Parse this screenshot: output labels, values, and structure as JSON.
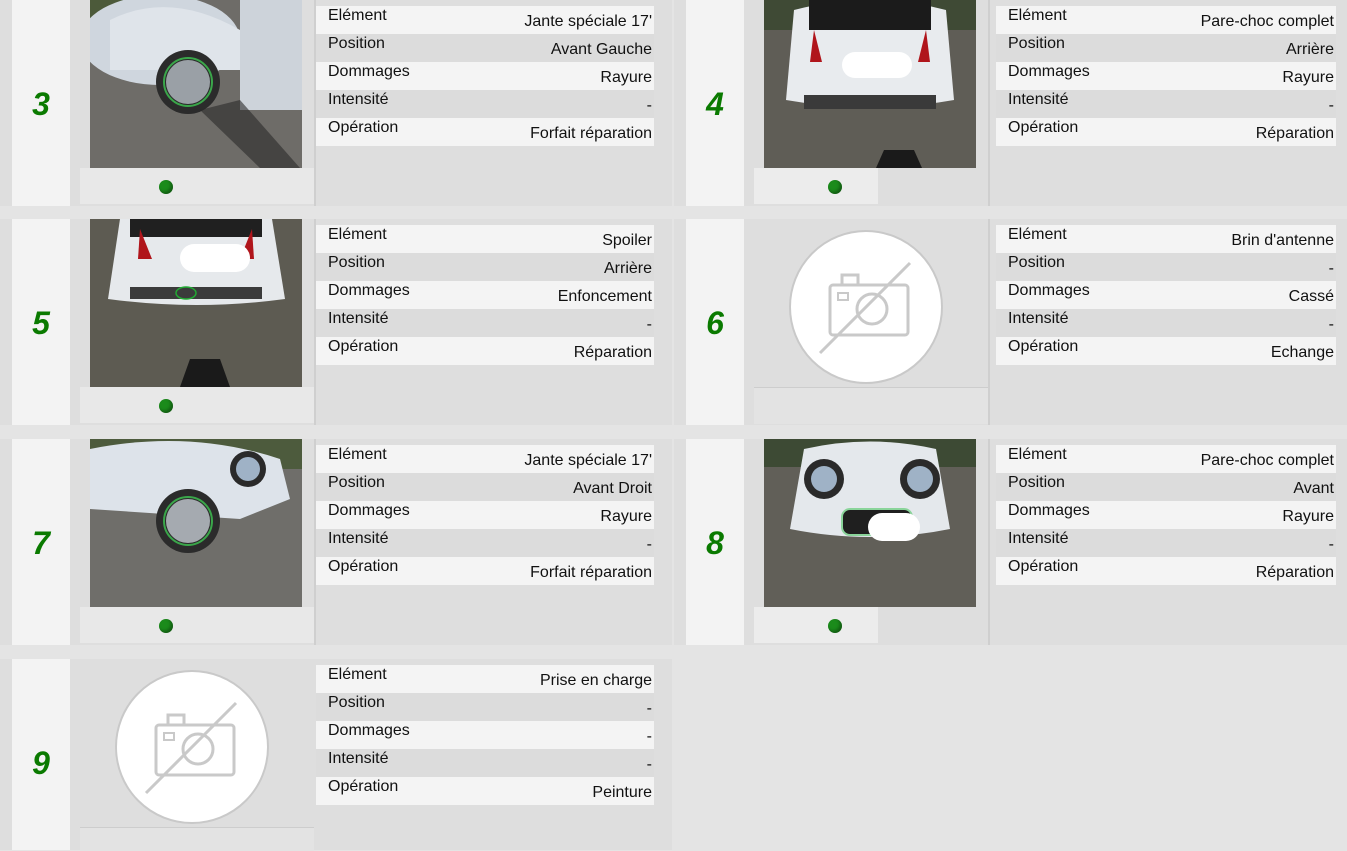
{
  "labels": {
    "element": "Elément",
    "position": "Position",
    "dommages": "Dommages",
    "intensite": "Intensité",
    "operation": "Opération"
  },
  "colors": {
    "number": "#0a7a00",
    "status_dot": "#1b8b1b"
  },
  "cards": [
    {
      "number": "3",
      "has_photo": true,
      "status": "ok",
      "element": "Jante spéciale 17'",
      "position": "Avant Gauche",
      "dommages": "Rayure",
      "intensite": "-",
      "operation": "Forfait réparation"
    },
    {
      "number": "4",
      "has_photo": true,
      "status": "ok",
      "element": "Pare-choc complet",
      "position": "Arrière",
      "dommages": "Rayure",
      "intensite": "-",
      "operation": "Réparation"
    },
    {
      "number": "5",
      "has_photo": true,
      "status": "ok",
      "element": "Spoiler",
      "position": "Arrière",
      "dommages": "Enfoncement",
      "intensite": "-",
      "operation": "Réparation"
    },
    {
      "number": "6",
      "has_photo": false,
      "status": "none",
      "element": "Brin d'antenne",
      "position": "-",
      "dommages": "Cassé",
      "intensite": "-",
      "operation": "Echange"
    },
    {
      "number": "7",
      "has_photo": true,
      "status": "ok",
      "element": "Jante spéciale 17'",
      "position": "Avant Droit",
      "dommages": "Rayure",
      "intensite": "-",
      "operation": "Forfait réparation"
    },
    {
      "number": "8",
      "has_photo": true,
      "status": "ok",
      "element": "Pare-choc complet",
      "position": "Avant",
      "dommages": "Rayure",
      "intensite": "-",
      "operation": "Réparation"
    },
    {
      "number": "9",
      "has_photo": false,
      "status": "none",
      "element": "Prise en charge",
      "position": "-",
      "dommages": "-",
      "intensite": "-",
      "operation": "Peinture"
    }
  ]
}
